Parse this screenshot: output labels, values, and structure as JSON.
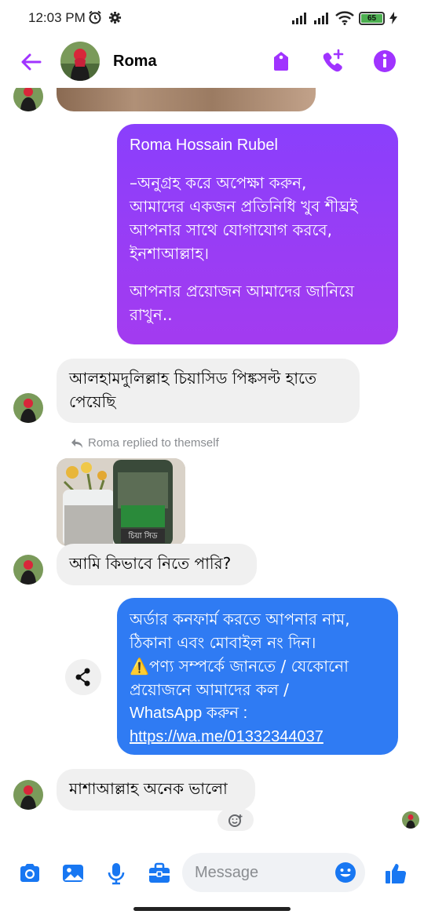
{
  "status_bar": {
    "time": "12:03 PM",
    "battery": "65",
    "icons": [
      "alarm-icon",
      "settings-icon",
      "signal-icon",
      "signal-icon",
      "wifi-icon",
      "battery-icon",
      "charging-icon"
    ]
  },
  "header": {
    "contact_name": "Roma",
    "icons": [
      "back-arrow-icon",
      "tag-icon",
      "phone-add-icon",
      "info-icon"
    ],
    "accent_color": "#a033ff"
  },
  "messages": [
    {
      "direction": "out",
      "lines": [
        "Roma Hossain Rubel",
        "",
        "–অনুগ্রহ করে অপেক্ষা করুন,",
        "আমাদের একজন প্রতিনিধি খুব শীঘ্রই",
        "আপনার সাথে যোগাযোগ করবে,",
        "ইনশাআল্লাহ।",
        "",
        "আপনার প্রয়োজন আমাদের জানিয়ে",
        "রাখুন.."
      ]
    },
    {
      "direction": "in",
      "lines": [
        "আলহামদুলিল্লাহ চিয়াসিড পিঙ্কসল্ট হাতে",
        "পেয়েছি"
      ]
    },
    {
      "direction": "in",
      "replied_label": "Roma replied to themself",
      "lines": [
        "আমি কিভাবে নিতে পারি?"
      ]
    },
    {
      "direction": "out",
      "lines": [
        "অর্ডার কনফার্ম করতে আপনার নাম,",
        "ঠিকানা এবং মোবাইল নং দিন।",
        "⚠️পণ্য সম্পর্কে জানতে / যেকোনো",
        "প্রয়োজনে আমাদের কল /",
        "WhatsApp করুন :"
      ],
      "link": "https://wa.me/01332344037"
    },
    {
      "direction": "in",
      "lines": [
        "মাশাআল্লাহ অনেক ভালো"
      ]
    }
  ],
  "composer": {
    "placeholder": "Message",
    "icons": [
      "camera-icon",
      "gallery-icon",
      "microphone-icon",
      "briefcase-icon",
      "emoji-icon",
      "thumbs-up-icon"
    ]
  },
  "colors": {
    "out_bubble_gradient_top": "#8a3ffc",
    "out_bubble_gradient_bottom": "#a83cf0",
    "out_bubble_blue": "#2f7bf3",
    "in_bubble": "#f0f0f0",
    "icon_blue": "#1877f2"
  }
}
